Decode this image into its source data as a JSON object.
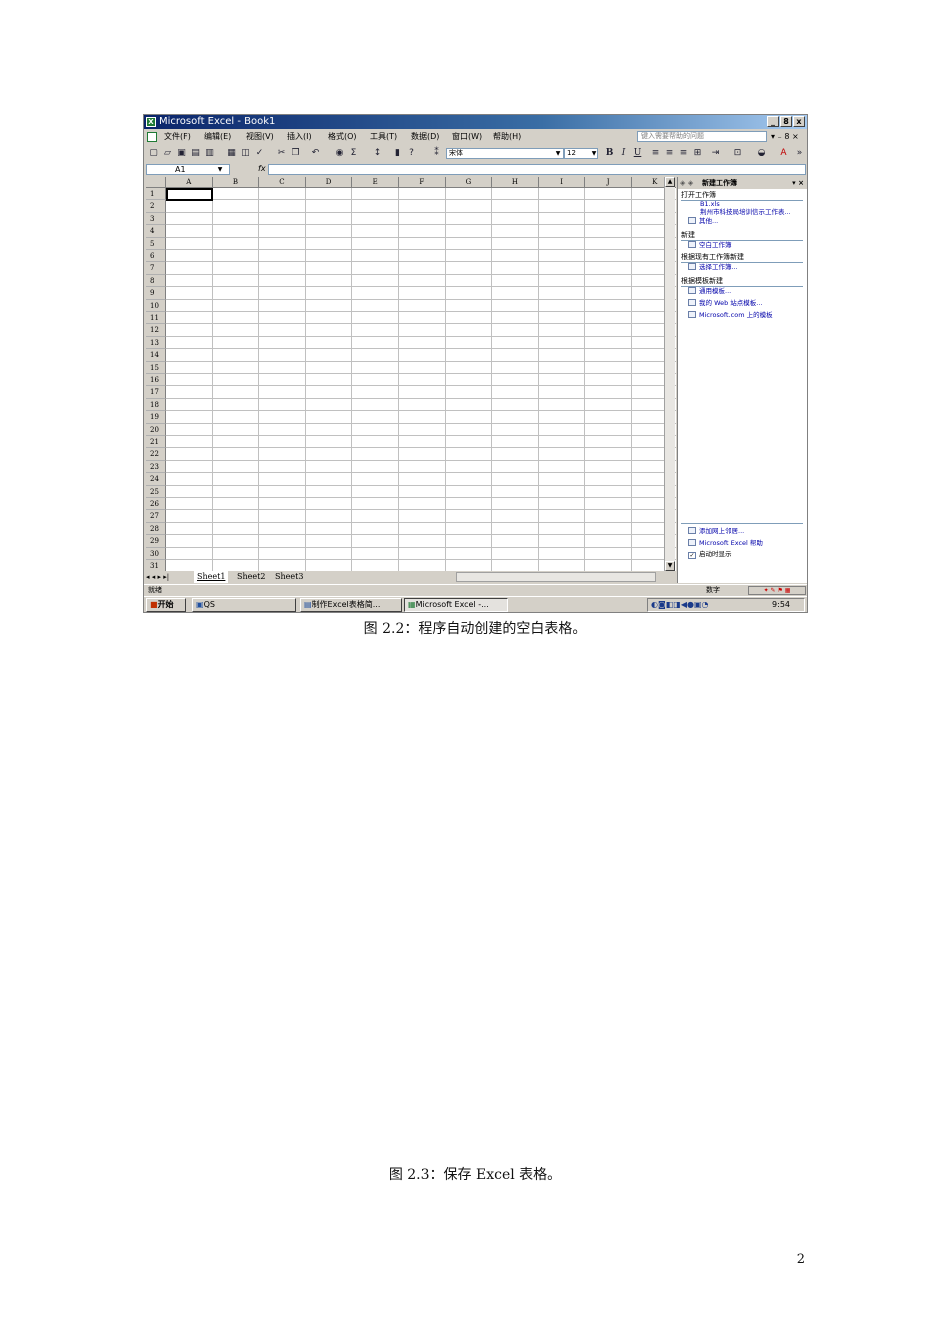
{
  "window": {
    "title": "Microsoft Excel - Book1",
    "min": "_",
    "max": "8",
    "close": "x"
  },
  "menubar": {
    "items": [
      "文件(F)",
      "编辑(E)",
      "视图(V)",
      "插入(I)",
      "格式(O)",
      "工具(T)",
      "数据(D)",
      "窗口(W)",
      "帮助(H)"
    ],
    "help_placeholder": "键入需要帮助的问题",
    "right_controls": "▾ ₋ 8 ×"
  },
  "toolbar": {
    "font_name": "宋体",
    "font_size": "12",
    "bold": "B",
    "italic": "I",
    "underline": "U"
  },
  "formula_bar": {
    "name_box": "A1",
    "fx_label": "fx"
  },
  "grid": {
    "columns": [
      "A",
      "B",
      "C",
      "D",
      "E",
      "F",
      "G",
      "H",
      "I",
      "J",
      "K"
    ],
    "rows": [
      "1",
      "2",
      "3",
      "4",
      "5",
      "6",
      "7",
      "8",
      "9",
      "10",
      "11",
      "12",
      "13",
      "14",
      "15",
      "16",
      "17",
      "18",
      "19",
      "20",
      "21",
      "22",
      "23",
      "24",
      "25",
      "26",
      "27",
      "28",
      "29",
      "30",
      "31"
    ]
  },
  "sheet_tabs": {
    "nav": "◂ ◂ ▸ ▸|",
    "tabs": [
      "Sheet1",
      "Sheet2",
      "Sheet3"
    ]
  },
  "status": {
    "left": "就绪",
    "right": "数字"
  },
  "task_pane": {
    "title": "新建工作簿",
    "sections": [
      {
        "heading": "打开工作簿",
        "links": [
          "B1.xls",
          "荆州市科技局培训信示工作表...",
          "其他..."
        ]
      },
      {
        "heading": "新建",
        "links": [
          "空白工作簿"
        ]
      },
      {
        "heading": "根据现有工作簿新建",
        "links": [
          "选择工作簿..."
        ]
      },
      {
        "heading": "根据模板新建",
        "links": [
          "通用模板...",
          "我的 Web 站点模板...",
          "Microsoft.com 上的模板"
        ]
      }
    ],
    "bottom_links": [
      "添加网上邻居...",
      "Microsoft Excel 帮助"
    ],
    "startup_checkbox": "启动时显示"
  },
  "taskbar": {
    "start": "开始",
    "quick": "QS",
    "tasks": [
      "制作Excel表格简...",
      "Microsoft Excel -..."
    ],
    "clock": "9:54"
  },
  "captions": {
    "fig22": "图 2.2：程序自动创建的空白表格。",
    "fig23": "图 2.3：保存 Excel 表格。"
  },
  "page_number": "2"
}
